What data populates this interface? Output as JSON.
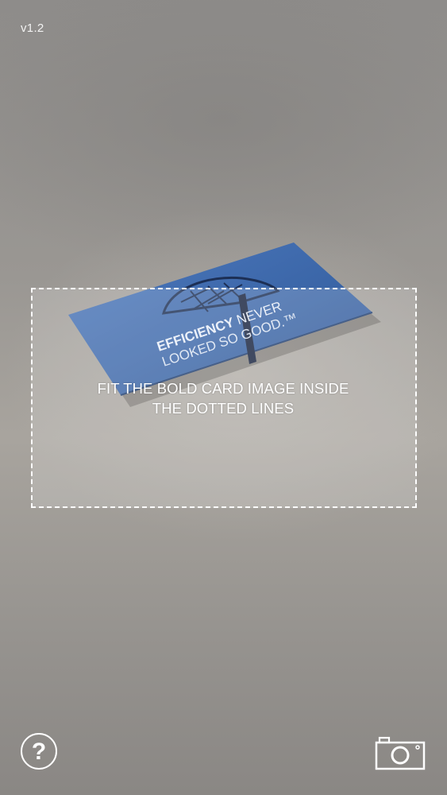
{
  "app": {
    "version": "v1.2"
  },
  "scan_frame": {
    "instruction_line1": "FIT THE BOLD CARD IMAGE INSIDE",
    "instruction_line2": "THE DOTTED LINES"
  },
  "card_preview": {
    "line1_bold": "EFFICIENCY",
    "line1_rest": " NEVER",
    "line2": "LOOKED SO GOOD.™",
    "card_color": "#3b66a8"
  },
  "controls": {
    "help_label": "?",
    "help_icon": "question-circle-icon",
    "capture_icon": "camera-icon"
  },
  "colors": {
    "overlay_text": "#ffffff",
    "frame_border": "#ffffff"
  }
}
